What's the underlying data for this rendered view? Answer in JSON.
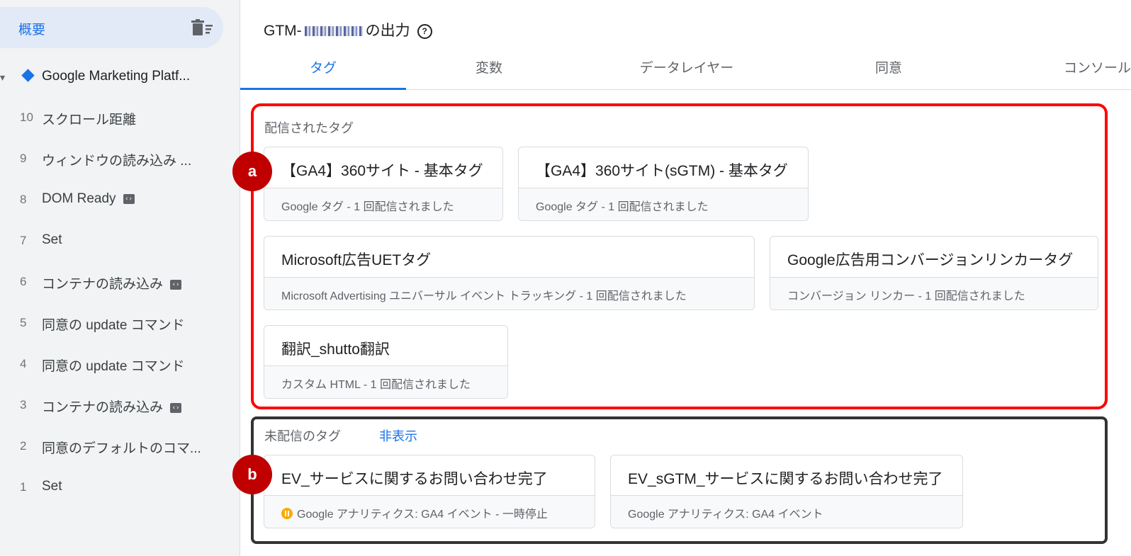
{
  "sidebar": {
    "summary_label": "概要",
    "summary_icon": "clear-list-icon",
    "container_label": "Google Marketing Platf...",
    "events": [
      {
        "num": "10",
        "label": "スクロール距離",
        "badge": false
      },
      {
        "num": "9",
        "label": "ウィンドウの読み込み ...",
        "badge": false
      },
      {
        "num": "8",
        "label": "DOM Ready",
        "badge": true
      },
      {
        "num": "7",
        "label": "Set",
        "badge": false
      },
      {
        "num": "6",
        "label": "コンテナの読み込み",
        "badge": true
      },
      {
        "num": "5",
        "label": "同意の update コマンド",
        "badge": false
      },
      {
        "num": "4",
        "label": "同意の update コマンド",
        "badge": false
      },
      {
        "num": "3",
        "label": "コンテナの読み込み",
        "badge": true
      },
      {
        "num": "2",
        "label": "同意のデフォルトのコマ...",
        "badge": false
      },
      {
        "num": "1",
        "label": "Set",
        "badge": false
      }
    ],
    "badge_glyph": "‹›"
  },
  "header": {
    "title_prefix": "GTM-",
    "title_suffix": "の出力",
    "help_glyph": "?"
  },
  "tabs": [
    "タグ",
    "変数",
    "データレイヤー",
    "同意",
    "コンソール"
  ],
  "fired": {
    "label": "配信されたタグ",
    "cards": [
      {
        "title": "【GA4】360サイト - 基本タグ",
        "subtitle": "Google タグ - 1 回配信されました"
      },
      {
        "title": "【GA4】360サイト(sGTM) - 基本タグ",
        "subtitle": "Google タグ - 1 回配信されました"
      },
      {
        "title": "Microsoft広告UETタグ",
        "subtitle": "Microsoft Advertising ユニバーサル イベント トラッキング - 1 回配信されました"
      },
      {
        "title": "Google広告用コンバージョンリンカータグ",
        "subtitle": "コンバージョン リンカー - 1 回配信されました"
      },
      {
        "title": "翻訳_shutto翻訳",
        "subtitle": "カスタム HTML - 1 回配信されました"
      }
    ]
  },
  "not_fired": {
    "label": "未配信のタグ",
    "hide_link": "非表示",
    "cards": [
      {
        "title": "EV_サービスに関するお問い合わせ完了",
        "subtitle": "Google アナリティクス: GA4 イベント - 一時停止",
        "paused": true
      },
      {
        "title": "EV_sGTM_サービスに関するお問い合わせ完了",
        "subtitle": "Google アナリティクス: GA4 イベント",
        "paused": false
      }
    ]
  },
  "markers": {
    "a": "a",
    "b": "b"
  },
  "colors": {
    "accent": "#1a73e8",
    "fired_border": "#ff0000",
    "not_fired_border": "#333333",
    "marker": "#c00000",
    "paused": "#f9ab00"
  }
}
